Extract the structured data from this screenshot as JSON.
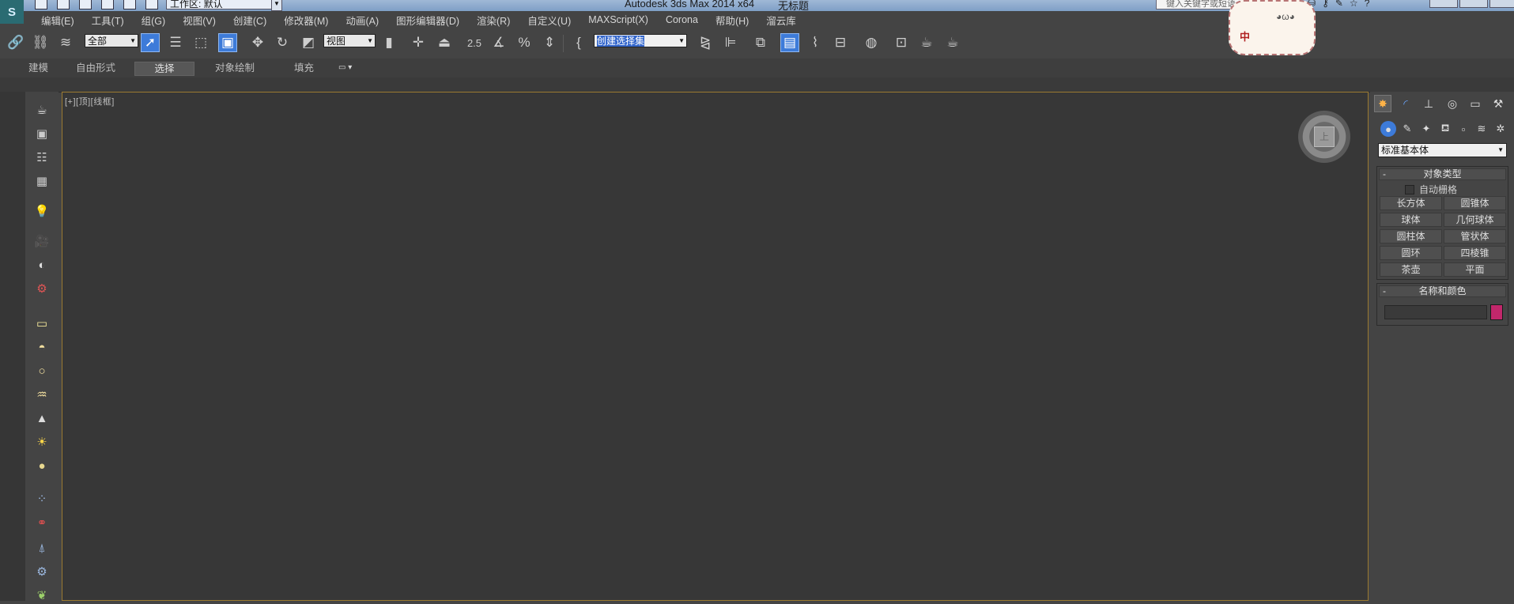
{
  "titlebar": {
    "workspace": "工作区: 默认",
    "app_title": "Autodesk 3ds Max  2014 x64",
    "doc_title": "无标题",
    "search_placeholder": "键入关键字或短语"
  },
  "menu": [
    "编辑(E)",
    "工具(T)",
    "组(G)",
    "视图(V)",
    "创建(C)",
    "修改器(M)",
    "动画(A)",
    "图形编辑器(D)",
    "渲染(R)",
    "自定义(U)",
    "MAXScript(X)",
    "Corona",
    "帮助(H)",
    "溜云库"
  ],
  "toolbar": {
    "filter_value": "全部",
    "refcoord_value": "视图",
    "snap_label": "2.5",
    "named_selection_value": "创建选择集"
  },
  "ribbon": {
    "tabs": [
      "建模",
      "自由形式",
      "选择",
      "对象绘制",
      "填充"
    ],
    "selected": "选择"
  },
  "viewport": {
    "label_plus": "[+]",
    "label_view": "[顶]",
    "label_shading": "[线框]",
    "viewcube_face": "上"
  },
  "sticker": {
    "text": "中"
  },
  "command_panel": {
    "category": "标准基本体",
    "object_type_title": "对象类型",
    "autogrid_label": "自动栅格",
    "buttons": [
      "长方体",
      "圆锥体",
      "球体",
      "几何球体",
      "圆柱体",
      "管状体",
      "圆环",
      "四棱锥",
      "茶壶",
      "平面"
    ],
    "name_color_title": "名称和颜色",
    "object_color": "#c2276b"
  },
  "colors": {
    "ui_bg": "#444444",
    "viewport_bg": "#373737",
    "viewport_border": "#9b7a30",
    "active_blue": "#3d7bd9"
  }
}
